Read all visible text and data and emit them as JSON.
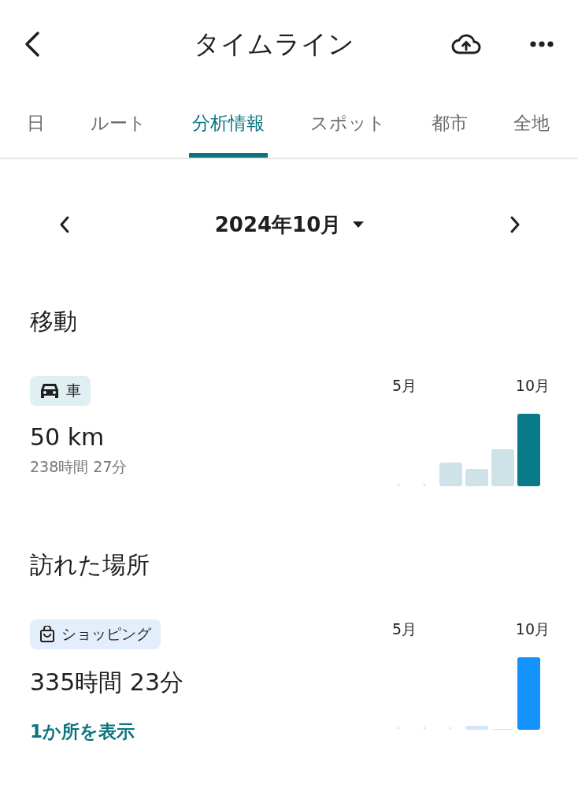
{
  "header": {
    "title": "タイムライン"
  },
  "tabs": [
    {
      "label": "日",
      "selected": false
    },
    {
      "label": "ルート",
      "selected": false
    },
    {
      "label": "分析情報",
      "selected": true
    },
    {
      "label": "スポット",
      "selected": false
    },
    {
      "label": "都市",
      "selected": false
    },
    {
      "label": "全地",
      "selected": false
    }
  ],
  "period": {
    "label": "2024年10月"
  },
  "sections": [
    {
      "heading": "移動",
      "category": {
        "kind": "car",
        "label": "車",
        "color": "#e0eff2"
      },
      "value": "50 km",
      "detail": "238時間 27分",
      "axis_labels": [
        "5月",
        "10月"
      ]
    },
    {
      "heading": "訪れた場所",
      "category": {
        "kind": "shopping",
        "label": "ショッピング",
        "color": "#e3eefb"
      },
      "value": "335時間 23分",
      "link": "1か所を表示",
      "axis_labels": [
        "5月",
        "10月"
      ]
    }
  ]
}
